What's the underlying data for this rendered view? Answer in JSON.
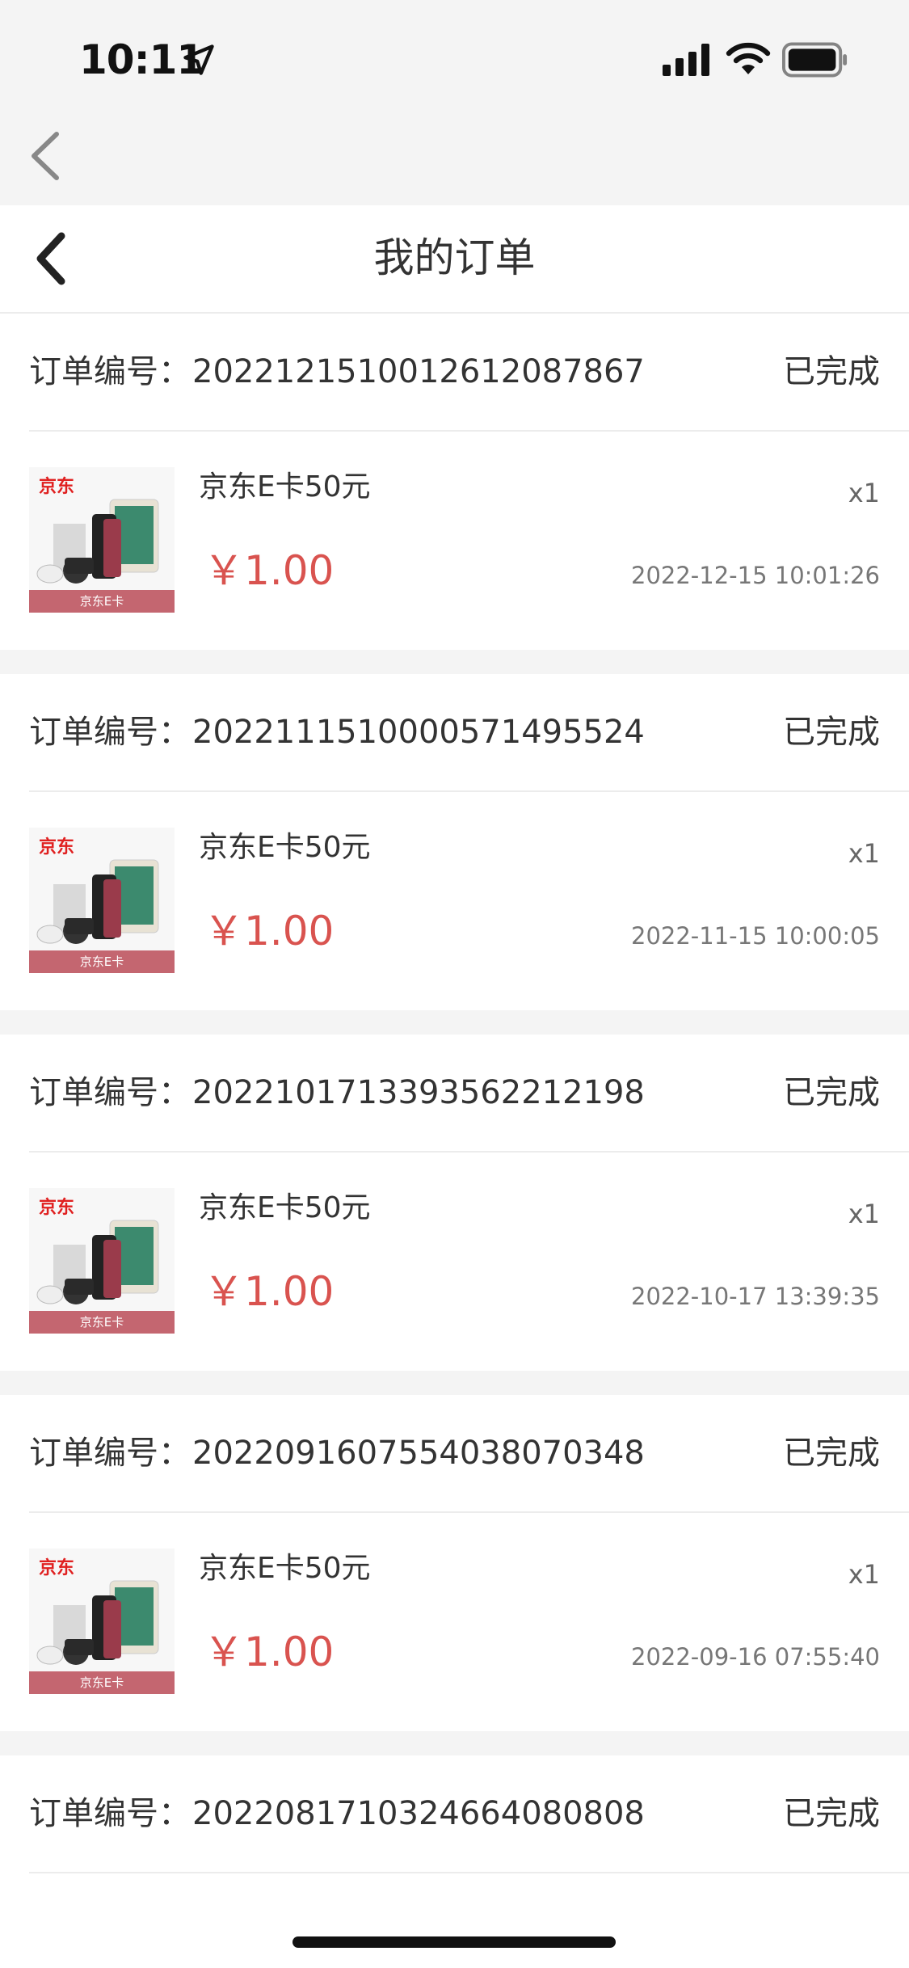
{
  "status_bar": {
    "time": "10:11",
    "icons": [
      "location-arrow-icon",
      "cellular-signal-icon",
      "wifi-icon",
      "battery-icon"
    ]
  },
  "header": {
    "title": "我的订单"
  },
  "labels": {
    "order_no": "订单编号："
  },
  "colors": {
    "price": "#d9534f",
    "background_gray": "#f4f4f4",
    "thumb_band": "#c46670",
    "brand_red": "#e02020"
  },
  "thumbnail": {
    "brand_text": "京东",
    "band_text": "京东E卡"
  },
  "orders": [
    {
      "order_no": "2022121510012612087867",
      "status": "已完成",
      "product_name": "京东E卡50元",
      "quantity": "x1",
      "price": "￥1.00",
      "datetime": "2022-12-15 10:01:26"
    },
    {
      "order_no": "2022111510000571495524",
      "status": "已完成",
      "product_name": "京东E卡50元",
      "quantity": "x1",
      "price": "￥1.00",
      "datetime": "2022-11-15 10:00:05"
    },
    {
      "order_no": "2022101713393562212198",
      "status": "已完成",
      "product_name": "京东E卡50元",
      "quantity": "x1",
      "price": "￥1.00",
      "datetime": "2022-10-17 13:39:35"
    },
    {
      "order_no": "2022091607554038070348",
      "status": "已完成",
      "product_name": "京东E卡50元",
      "quantity": "x1",
      "price": "￥1.00",
      "datetime": "2022-09-16 07:55:40"
    },
    {
      "order_no": "2022081710324664080808",
      "status": "已完成"
    }
  ]
}
